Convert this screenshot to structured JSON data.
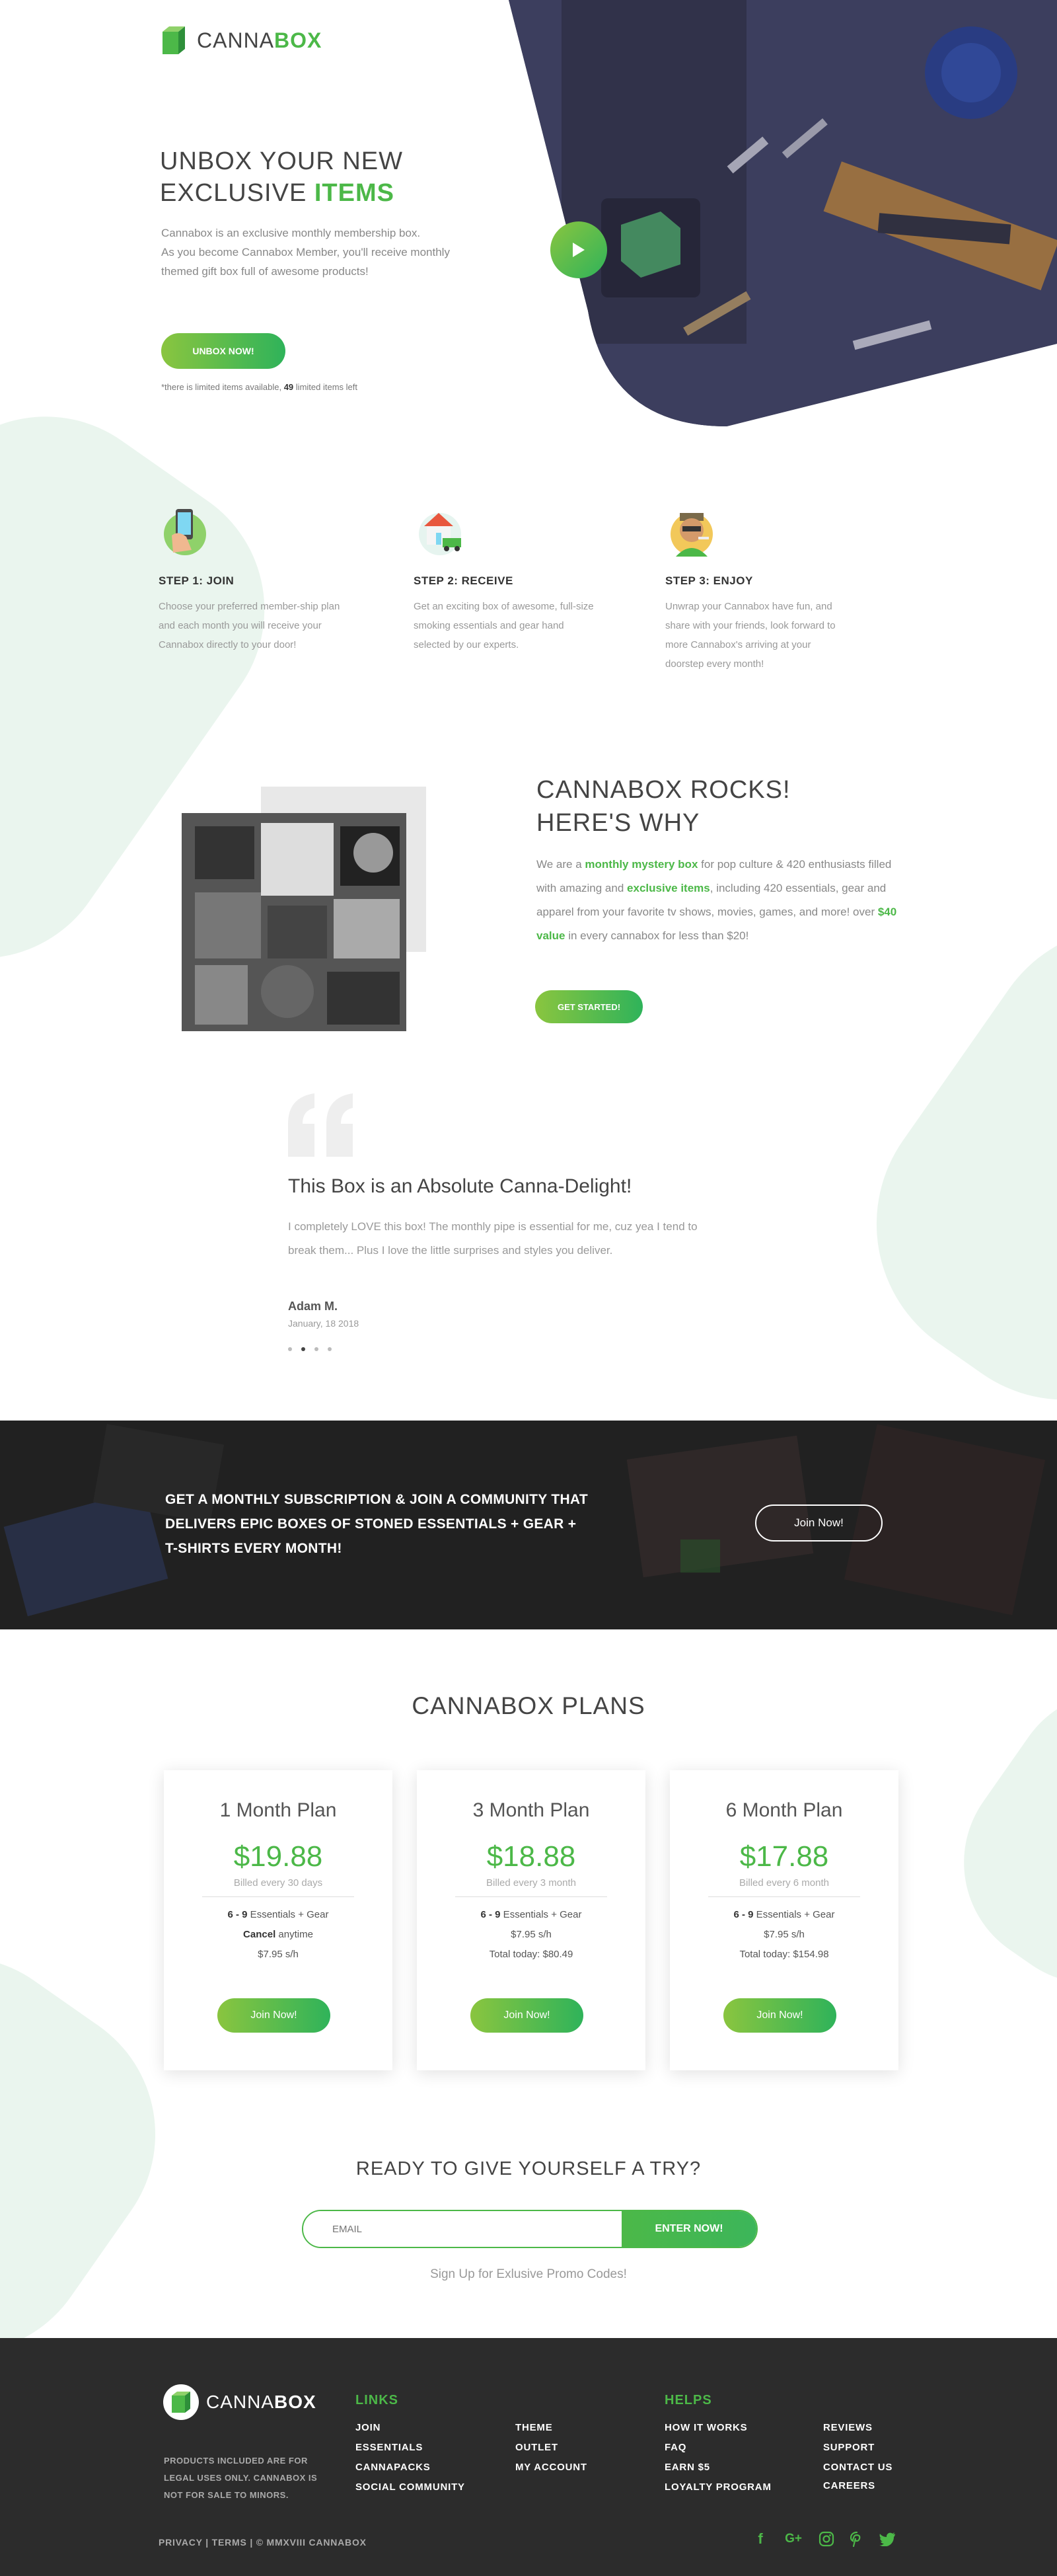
{
  "brand": {
    "name_part1": "CANNA",
    "name_part2": "BOX"
  },
  "hero": {
    "title_line1": "UNBOX YOUR NEW",
    "title_word": "EXCLUSIVE",
    "title_highlight": "ITEMS",
    "desc_line1": "Cannabox is an exclusive monthly membership box.",
    "desc_line2": "As you become Cannabox Member, you'll receive monthly",
    "desc_line3": "themed gift box full of awesome products!",
    "button": "UNBOX NOW!",
    "note_prefix": "*there is limited items available,",
    "note_count": "49",
    "note_suffix": "limited items left"
  },
  "steps": [
    {
      "title": "STEP 1: JOIN",
      "desc": "Choose your preferred member-ship plan and each month you will receive your Cannabox directly to your door!"
    },
    {
      "title": "STEP 2: RECEIVE",
      "desc": "Get an exciting box of awesome, full-size smoking essentials and gear hand selected by our experts."
    },
    {
      "title": "STEP 3: ENJOY",
      "desc": "Unwrap your Cannabox have fun, and share with your friends, look forward to more Cannabox's arriving at your doorstep every month!"
    }
  ],
  "rocks": {
    "title_line1": "CANNABOX ROCKS!",
    "title_line2": "HERE'S WHY",
    "p1": "We are a",
    "p1_hl": "monthly mystery box",
    "p2": "for pop culture & 420 enthusiasts filled with amazing and",
    "p2_hl": "exclusive items",
    "p3": ", including 420 essentials, gear and apparel from your favorite tv shows, movies, games, and more! over",
    "p3_hl": "$40 value",
    "p4": "in every cannabox for less than $20!",
    "button": "GET STARTED!"
  },
  "testimonial": {
    "title": "This Box is an Absolute Canna-Delight!",
    "body": "I completely LOVE this box! The monthly pipe is essential for me, cuz yea I tend to break them... Plus I love the little surprises and styles you deliver.",
    "name": "Adam M.",
    "date": "January, 18 2018"
  },
  "banner": {
    "text_line1": "GET A MONTHLY SUBSCRIPTION & JOIN A COMMUNITY THAT",
    "text_line2": "DELIVERS EPIC BOXES OF STONED ESSENTIALS + GEAR +",
    "text_line3": "T-SHIRTS EVERY MONTH!",
    "button": "Join Now!"
  },
  "plans": {
    "title": "CANNABOX PLANS",
    "items": [
      {
        "name": "1 Month Plan",
        "price": "$19.88",
        "billed": "Billed every 30 days",
        "l1_b": "6 - 9",
        "l1": " Essentials + Gear",
        "l2_b": "Cancel",
        "l2": " anytime",
        "l3": "$7.95 s/h",
        "button": "Join Now!"
      },
      {
        "name": "3 Month Plan",
        "price": "$18.88",
        "billed": "Billed every 3 month",
        "l1_b": "6 - 9",
        "l1": " Essentials + Gear",
        "l2_b": "",
        "l2": "$7.95 s/h",
        "l3": "Total today: $80.49",
        "button": "Join Now!"
      },
      {
        "name": "6 Month Plan",
        "price": "$17.88",
        "billed": "Billed every 6 month",
        "l1_b": "6 - 9",
        "l1": " Essentials + Gear",
        "l2_b": "",
        "l2": "$7.95 s/h",
        "l3": "Total today: $154.98",
        "button": "Join Now!"
      }
    ]
  },
  "ready": {
    "title": "READY TO GIVE YOURSELF A TRY?",
    "email_placeholder": "EMAIL",
    "button": "ENTER NOW!",
    "promo": "Sign Up for Exlusive Promo Codes!"
  },
  "footer": {
    "disclaimer": "PRODUCTS INCLUDED ARE FOR LEGAL USES ONLY. CANNABOX IS NOT FOR SALE TO MINORS.",
    "links_heading": "LINKS",
    "links_col1": [
      "JOIN",
      "ESSENTIALS",
      "CANNAPACKS",
      "SOCIAL COMMUNITY"
    ],
    "links_col2": [
      "THEME",
      "OUTLET",
      "MY ACCOUNT"
    ],
    "helps_heading": "HELPS",
    "helps_col1": [
      "HOW IT WORKS",
      "FAQ",
      "EARN $5",
      "LOYALTY PROGRAM"
    ],
    "helps_col2": [
      "REVIEWS",
      "SUPPORT",
      "CONTACT US",
      "CAREERS"
    ],
    "bottom": "PRIVACY | TERMS | © MMXVIII CANNABOX",
    "social_icons": [
      "facebook-icon",
      "google-plus-icon",
      "instagram-icon",
      "pinterest-icon",
      "twitter-icon"
    ]
  },
  "colors": {
    "accent": "#4cb848",
    "dark": "#2c2c2c"
  }
}
